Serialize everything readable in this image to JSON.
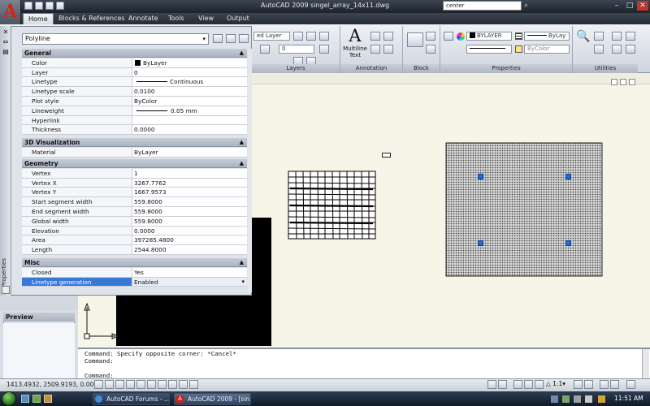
{
  "window": {
    "title": "AutoCAD 2009  singel_array_14x11.dwg",
    "search_value": "center"
  },
  "tabs": [
    "Home",
    "Blocks & References",
    "Annotate",
    "Tools",
    "View",
    "Output"
  ],
  "ribbon": {
    "layer_combo": "ed Layer",
    "layer_num": "0",
    "layers_label": "Layers",
    "multiline_text_label": "Multiline Text",
    "annotation_label": "Annotation",
    "block_label": "Block",
    "color_combo": "BYLAYER",
    "linetype_combo": "ByLay",
    "bycolor_combo": "ByColor",
    "properties_label": "Properties",
    "utilities_label": "Utilities"
  },
  "properties_palette": {
    "object_type": "Polyline",
    "side_label": "Properties",
    "sections": {
      "general": {
        "title": "General",
        "rows": [
          {
            "key": "Color",
            "value": "ByLayer"
          },
          {
            "key": "Layer",
            "value": "0"
          },
          {
            "key": "Linetype",
            "value": "Continuous"
          },
          {
            "key": "Linetype scale",
            "value": "0.0100"
          },
          {
            "key": "Plot style",
            "value": "ByColor"
          },
          {
            "key": "Lineweight",
            "value": "0.05 mm"
          },
          {
            "key": "Hyperlink",
            "value": ""
          },
          {
            "key": "Thickness",
            "value": "0.0000"
          }
        ]
      },
      "viz3d": {
        "title": "3D Visualization",
        "rows": [
          {
            "key": "Material",
            "value": "ByLayer"
          }
        ]
      },
      "geometry": {
        "title": "Geometry",
        "rows": [
          {
            "key": "Vertex",
            "value": "1"
          },
          {
            "key": "Vertex X",
            "value": "3267.7762"
          },
          {
            "key": "Vertex Y",
            "value": "1667.9573"
          },
          {
            "key": "Start segment width",
            "value": "559.8000"
          },
          {
            "key": "End segment width",
            "value": "559.8000"
          },
          {
            "key": "Global width",
            "value": "559.8000"
          },
          {
            "key": "Elevation",
            "value": "0.0000"
          },
          {
            "key": "Area",
            "value": "397285.4800"
          },
          {
            "key": "Length",
            "value": "2544.8000"
          }
        ]
      },
      "misc": {
        "title": "Misc",
        "rows": [
          {
            "key": "Closed",
            "value": "Yes"
          },
          {
            "key": "Linetype generation",
            "value": "Enabled"
          }
        ]
      }
    }
  },
  "preview": {
    "title": "Preview"
  },
  "command_window": {
    "lines": [
      "Command: Specify opposite corner: *Cancel*",
      "Command:",
      "Command:"
    ]
  },
  "status_bar": {
    "coordinates": "1413.4932, 2509.9193, 0.0000",
    "scale": "1:1"
  },
  "taskbar": {
    "items": [
      "AutoCAD Forums - ...",
      "AutoCAD 2009 - [sin..."
    ],
    "clock": "11:51 AM"
  },
  "colors": {
    "selection": "#3a78d6",
    "grip": "#1d6fd8",
    "drawing_bg": "#f7f5e7",
    "app_logo": "#d0241c"
  }
}
